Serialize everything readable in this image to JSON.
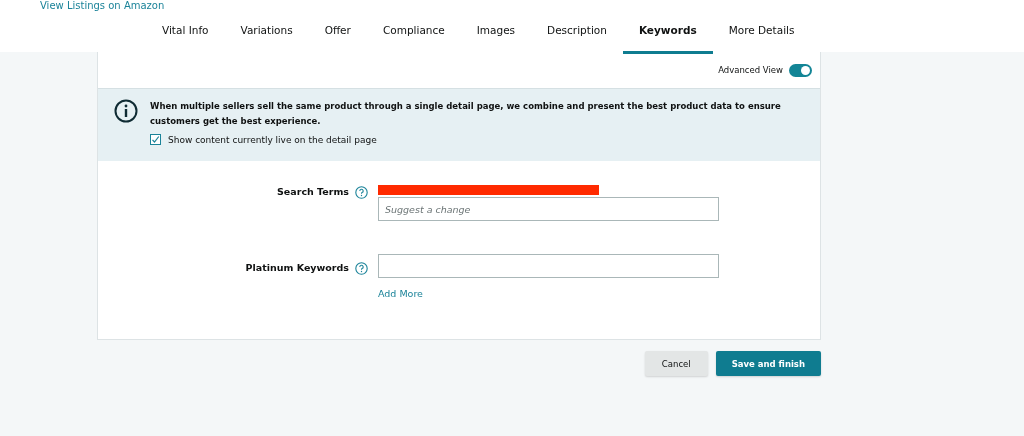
{
  "top_link": "View Listings on Amazon",
  "tabs": [
    {
      "label": "Vital Info",
      "selected": false
    },
    {
      "label": "Variations",
      "selected": false
    },
    {
      "label": "Offer",
      "selected": false
    },
    {
      "label": "Compliance",
      "selected": false
    },
    {
      "label": "Images",
      "selected": false
    },
    {
      "label": "Description",
      "selected": false
    },
    {
      "label": "Keywords",
      "selected": true
    },
    {
      "label": "More Details",
      "selected": false
    }
  ],
  "advanced_view": {
    "label": "Advanced View",
    "on": true
  },
  "notice": {
    "text": "When multiple sellers sell the same product through a single detail page, we combine and present the best product data to ensure customers get the best experience.",
    "checkbox": {
      "label": "Show content currently live on the detail page",
      "checked": true
    }
  },
  "fields": [
    {
      "label": "Search Terms",
      "redacted": true,
      "placeholder": "Suggest a change"
    },
    {
      "label": "Platinum Keywords",
      "redacted": false
    }
  ],
  "add_more": "Add More",
  "buttons": [
    {
      "label": "Cancel",
      "kind": "secondary"
    },
    {
      "label": "Save and finish",
      "kind": "primary"
    }
  ]
}
